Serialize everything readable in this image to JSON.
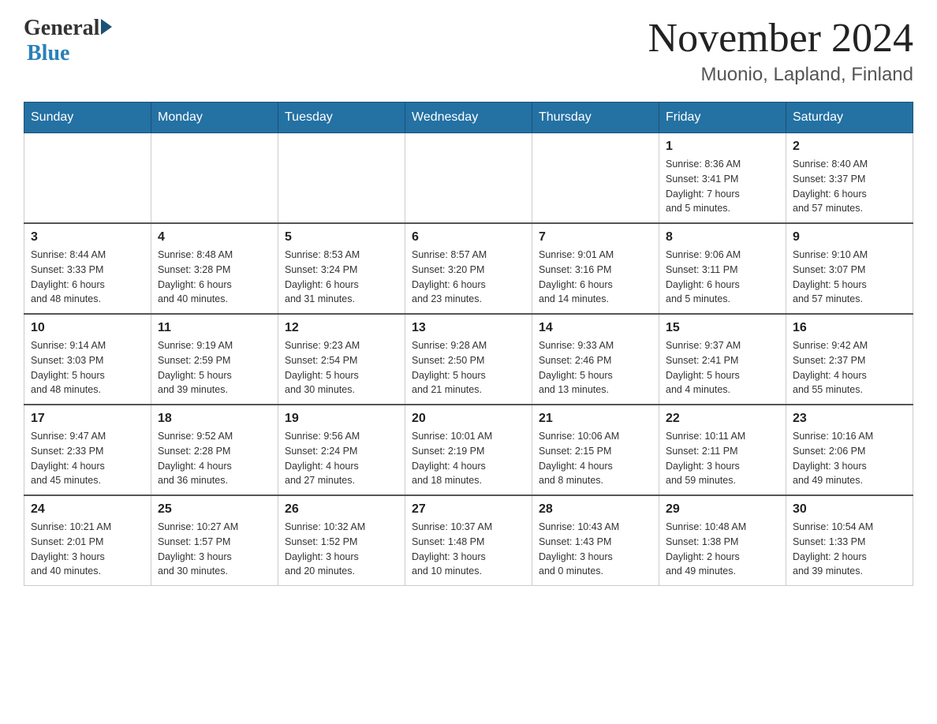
{
  "header": {
    "logo_general": "General",
    "logo_blue": "Blue",
    "month_title": "November 2024",
    "location": "Muonio, Lapland, Finland"
  },
  "weekdays": [
    "Sunday",
    "Monday",
    "Tuesday",
    "Wednesday",
    "Thursday",
    "Friday",
    "Saturday"
  ],
  "weeks": [
    [
      {
        "day": "",
        "info": ""
      },
      {
        "day": "",
        "info": ""
      },
      {
        "day": "",
        "info": ""
      },
      {
        "day": "",
        "info": ""
      },
      {
        "day": "",
        "info": ""
      },
      {
        "day": "1",
        "info": "Sunrise: 8:36 AM\nSunset: 3:41 PM\nDaylight: 7 hours\nand 5 minutes."
      },
      {
        "day": "2",
        "info": "Sunrise: 8:40 AM\nSunset: 3:37 PM\nDaylight: 6 hours\nand 57 minutes."
      }
    ],
    [
      {
        "day": "3",
        "info": "Sunrise: 8:44 AM\nSunset: 3:33 PM\nDaylight: 6 hours\nand 48 minutes."
      },
      {
        "day": "4",
        "info": "Sunrise: 8:48 AM\nSunset: 3:28 PM\nDaylight: 6 hours\nand 40 minutes."
      },
      {
        "day": "5",
        "info": "Sunrise: 8:53 AM\nSunset: 3:24 PM\nDaylight: 6 hours\nand 31 minutes."
      },
      {
        "day": "6",
        "info": "Sunrise: 8:57 AM\nSunset: 3:20 PM\nDaylight: 6 hours\nand 23 minutes."
      },
      {
        "day": "7",
        "info": "Sunrise: 9:01 AM\nSunset: 3:16 PM\nDaylight: 6 hours\nand 14 minutes."
      },
      {
        "day": "8",
        "info": "Sunrise: 9:06 AM\nSunset: 3:11 PM\nDaylight: 6 hours\nand 5 minutes."
      },
      {
        "day": "9",
        "info": "Sunrise: 9:10 AM\nSunset: 3:07 PM\nDaylight: 5 hours\nand 57 minutes."
      }
    ],
    [
      {
        "day": "10",
        "info": "Sunrise: 9:14 AM\nSunset: 3:03 PM\nDaylight: 5 hours\nand 48 minutes."
      },
      {
        "day": "11",
        "info": "Sunrise: 9:19 AM\nSunset: 2:59 PM\nDaylight: 5 hours\nand 39 minutes."
      },
      {
        "day": "12",
        "info": "Sunrise: 9:23 AM\nSunset: 2:54 PM\nDaylight: 5 hours\nand 30 minutes."
      },
      {
        "day": "13",
        "info": "Sunrise: 9:28 AM\nSunset: 2:50 PM\nDaylight: 5 hours\nand 21 minutes."
      },
      {
        "day": "14",
        "info": "Sunrise: 9:33 AM\nSunset: 2:46 PM\nDaylight: 5 hours\nand 13 minutes."
      },
      {
        "day": "15",
        "info": "Sunrise: 9:37 AM\nSunset: 2:41 PM\nDaylight: 5 hours\nand 4 minutes."
      },
      {
        "day": "16",
        "info": "Sunrise: 9:42 AM\nSunset: 2:37 PM\nDaylight: 4 hours\nand 55 minutes."
      }
    ],
    [
      {
        "day": "17",
        "info": "Sunrise: 9:47 AM\nSunset: 2:33 PM\nDaylight: 4 hours\nand 45 minutes."
      },
      {
        "day": "18",
        "info": "Sunrise: 9:52 AM\nSunset: 2:28 PM\nDaylight: 4 hours\nand 36 minutes."
      },
      {
        "day": "19",
        "info": "Sunrise: 9:56 AM\nSunset: 2:24 PM\nDaylight: 4 hours\nand 27 minutes."
      },
      {
        "day": "20",
        "info": "Sunrise: 10:01 AM\nSunset: 2:19 PM\nDaylight: 4 hours\nand 18 minutes."
      },
      {
        "day": "21",
        "info": "Sunrise: 10:06 AM\nSunset: 2:15 PM\nDaylight: 4 hours\nand 8 minutes."
      },
      {
        "day": "22",
        "info": "Sunrise: 10:11 AM\nSunset: 2:11 PM\nDaylight: 3 hours\nand 59 minutes."
      },
      {
        "day": "23",
        "info": "Sunrise: 10:16 AM\nSunset: 2:06 PM\nDaylight: 3 hours\nand 49 minutes."
      }
    ],
    [
      {
        "day": "24",
        "info": "Sunrise: 10:21 AM\nSunset: 2:01 PM\nDaylight: 3 hours\nand 40 minutes."
      },
      {
        "day": "25",
        "info": "Sunrise: 10:27 AM\nSunset: 1:57 PM\nDaylight: 3 hours\nand 30 minutes."
      },
      {
        "day": "26",
        "info": "Sunrise: 10:32 AM\nSunset: 1:52 PM\nDaylight: 3 hours\nand 20 minutes."
      },
      {
        "day": "27",
        "info": "Sunrise: 10:37 AM\nSunset: 1:48 PM\nDaylight: 3 hours\nand 10 minutes."
      },
      {
        "day": "28",
        "info": "Sunrise: 10:43 AM\nSunset: 1:43 PM\nDaylight: 3 hours\nand 0 minutes."
      },
      {
        "day": "29",
        "info": "Sunrise: 10:48 AM\nSunset: 1:38 PM\nDaylight: 2 hours\nand 49 minutes."
      },
      {
        "day": "30",
        "info": "Sunrise: 10:54 AM\nSunset: 1:33 PM\nDaylight: 2 hours\nand 39 minutes."
      }
    ]
  ]
}
